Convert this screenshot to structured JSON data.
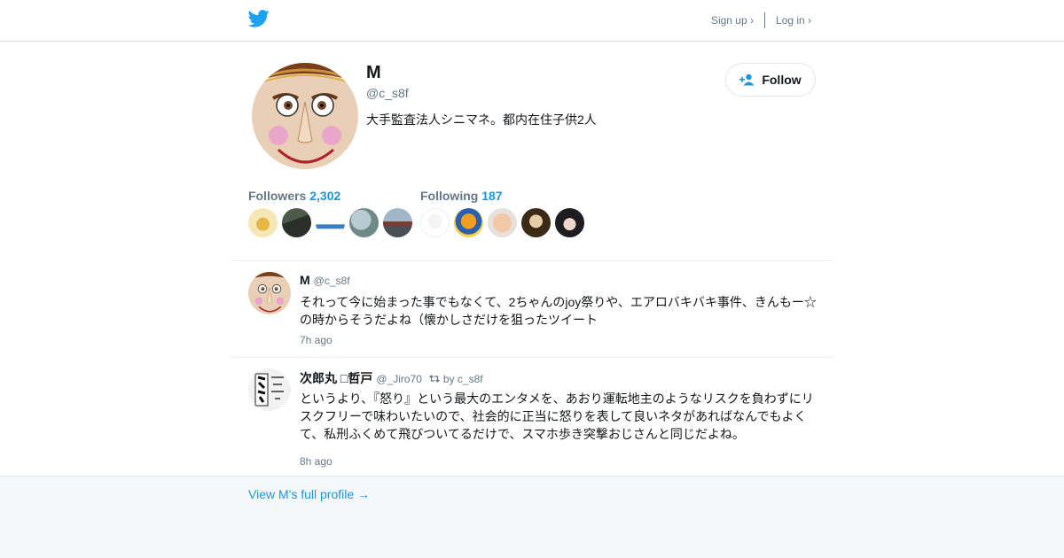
{
  "header": {
    "logo_icon": "twitter-bird-icon",
    "signup_label": "Sign up ›",
    "login_label": "Log in ›"
  },
  "profile": {
    "name": "M",
    "handle": "@c_s8f",
    "bio": "大手監査法人シニマネ。都内在住子供2人",
    "follow_label": "Follow",
    "followers_label": "Followers",
    "followers_count": "2,302",
    "following_label": "Following",
    "following_count": "187"
  },
  "tweets": [
    {
      "name": "M",
      "handle": "@c_s8f",
      "retweet_by": "",
      "text": "それって今に始まった事でもなくて、2ちゃんのjoy祭りや、エアロバキバキ事件、きんもー☆の時からそうだよね（懐かしさだけを狙ったツイート",
      "time": "7h ago"
    },
    {
      "name": "次郎丸 □哲戸",
      "handle": "@_Jiro70",
      "retweet_by": "by c_s8f",
      "text": "というより、『怒り』という最大のエンタメを、あおり運転地主のようなリスクを負わずにリスクフリーで味わいたいので、社会的に正当に怒りを表して良いネタがあればなんでもよくて、私刑ふくめて飛びついてるだけで、スマホ歩き突撃おじさんと同じだよね。",
      "time": "8h ago"
    }
  ],
  "footer": {
    "full_profile_link": "View M's full profile →"
  },
  "colors": {
    "accent": "#1b95e0",
    "twitter_blue": "#1da1f2",
    "muted": "#657786",
    "footer_bg": "#f5f8fa"
  }
}
